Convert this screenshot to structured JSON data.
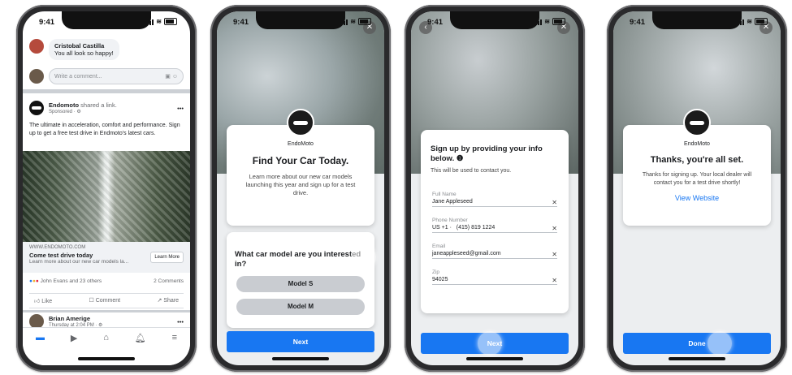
{
  "status": {
    "time": "9:41"
  },
  "phone1": {
    "comment": {
      "name": "Cristobal Castilla",
      "text": "You all look so happy!"
    },
    "write_placeholder": "Write a comment...",
    "post": {
      "advertiser": "Endomoto",
      "shared": "shared a link.",
      "sponsored": "Sponsored · ⚙",
      "body": "The ultimate in acceleration, comfort and performance. Sign up to get a free test drive in Endmoto's latest cars.",
      "domain": "WWW.ENDOMOTO.COM",
      "link_title": "Come test drive today",
      "link_desc": "Learn more about our new car models la...",
      "learn_more": "Learn More",
      "reactions": "John Evans and 23 others",
      "comments_count": "2 Comments",
      "like": "Like",
      "comment": "Comment",
      "share": "Share"
    },
    "next_post": {
      "name": "Brian Amerige",
      "meta": "Thursday at 2:04 PM · ⚙"
    }
  },
  "phone2": {
    "brand": "EndoMoto",
    "title": "Find Your Car Today.",
    "desc": "Learn more about our new car models launching this year and sign up for a test drive.",
    "question": "What car model are you interested in?",
    "options": [
      "Model S",
      "Model M"
    ],
    "next": "Next"
  },
  "phone3": {
    "title": "Sign up by providing your info below.",
    "subtitle": "This will be used to contact you.",
    "fields": [
      {
        "label": "Full Name",
        "value": "Jane Appleseed"
      },
      {
        "label": "Phone Number",
        "value": "(415) 819 1224",
        "prefix": "US +1 ·"
      },
      {
        "label": "Email",
        "value": "janeappleseed@gmail.com"
      },
      {
        "label": "Zip",
        "value": "94025"
      }
    ],
    "next": "Next"
  },
  "phone4": {
    "brand": "EndoMoto",
    "title": "Thanks, you're all set.",
    "desc": "Thanks for signing up. Your local dealer will contact you for a test drive shortly!",
    "link": "View Website",
    "done": "Done"
  },
  "colors": {
    "accent": "#1877f2"
  }
}
